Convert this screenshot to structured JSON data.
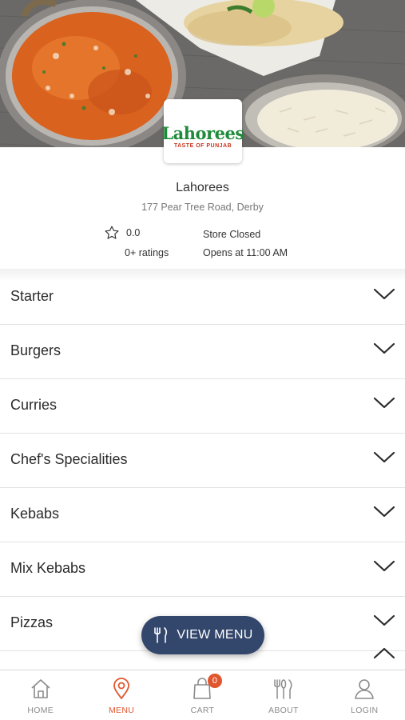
{
  "restaurant": {
    "logo_text": "Lahorees",
    "logo_tagline": "TASTE OF PUNJAB",
    "name": "Lahorees",
    "address": "177 Pear Tree Road, Derby",
    "rating_value": "0.0",
    "rating_count": "0+ ratings",
    "store_status": "Store Closed",
    "opens_at": "Opens at 11:00 AM"
  },
  "categories": [
    {
      "label": "Starter"
    },
    {
      "label": "Burgers"
    },
    {
      "label": "Curries"
    },
    {
      "label": "Chef's Specialities"
    },
    {
      "label": "Kebabs"
    },
    {
      "label": "Mix Kebabs"
    },
    {
      "label": "Pizzas"
    }
  ],
  "view_menu_label": "VIEW MENU",
  "bottom_nav": {
    "items": [
      {
        "label": "HOME",
        "icon": "home-icon"
      },
      {
        "label": "MENU",
        "icon": "location-pin-icon",
        "active": true
      },
      {
        "label": "CART",
        "icon": "shopping-bag-icon",
        "badge": "0"
      },
      {
        "label": "ABOUT",
        "icon": "cutlery-icon"
      },
      {
        "label": "LOGIN",
        "icon": "user-icon"
      }
    ]
  },
  "colors": {
    "accent": "#e0562e",
    "button": "#33466b",
    "logo_green": "#1f8a3a",
    "logo_red": "#c8361d"
  }
}
